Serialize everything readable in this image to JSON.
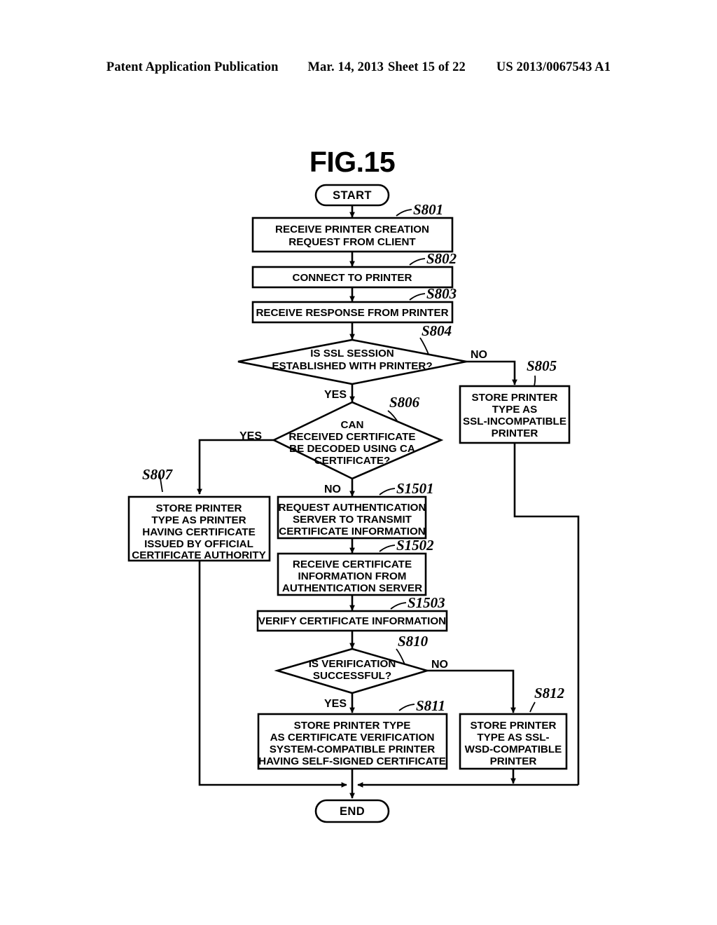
{
  "header": {
    "publication": "Patent Application Publication",
    "date": "Mar. 14, 2013",
    "sheet": "Sheet 15 of 22",
    "number": "US 2013/0067543 A1"
  },
  "figure": {
    "title": "FIG.15"
  },
  "nodes": {
    "start": {
      "id": "START",
      "text": "START",
      "type": "terminator"
    },
    "end": {
      "id": "END",
      "text": "END",
      "type": "terminator"
    },
    "s801": {
      "label": "S801",
      "type": "process",
      "lines": [
        "RECEIVE PRINTER CREATION",
        "REQUEST FROM CLIENT"
      ]
    },
    "s802": {
      "label": "S802",
      "type": "process",
      "lines": [
        "CONNECT TO PRINTER"
      ]
    },
    "s803": {
      "label": "S803",
      "type": "process",
      "lines": [
        "RECEIVE RESPONSE FROM PRINTER"
      ]
    },
    "s804": {
      "label": "S804",
      "type": "decision",
      "lines": [
        "IS SSL SESSION",
        "ESTABLISHED WITH PRINTER?"
      ],
      "yes": "YES",
      "no": "NO"
    },
    "s805": {
      "label": "S805",
      "type": "process",
      "lines": [
        "STORE PRINTER",
        "TYPE AS",
        "SSL-INCOMPATIBLE",
        "PRINTER"
      ]
    },
    "s806": {
      "label": "S806",
      "type": "decision",
      "lines": [
        "CAN",
        "RECEIVED CERTIFICATE",
        "BE DECODED USING CA",
        "CERTIFICATE?"
      ],
      "yes": "YES",
      "no": "NO"
    },
    "s807": {
      "label": "S807",
      "type": "process",
      "lines": [
        "STORE PRINTER",
        "TYPE AS PRINTER",
        "HAVING CERTIFICATE",
        "ISSUED BY OFFICIAL",
        "CERTIFICATE AUTHORITY"
      ]
    },
    "s1501": {
      "label": "S1501",
      "type": "process",
      "lines": [
        "REQUEST AUTHENTICATION",
        "SERVER TO TRANSMIT",
        "CERTIFICATE INFORMATION"
      ]
    },
    "s1502": {
      "label": "S1502",
      "type": "process",
      "lines": [
        "RECEIVE CERTIFICATE",
        "INFORMATION FROM",
        "AUTHENTICATION SERVER"
      ]
    },
    "s1503": {
      "label": "S1503",
      "type": "process",
      "lines": [
        "VERIFY CERTIFICATE INFORMATION"
      ]
    },
    "s810": {
      "label": "S810",
      "type": "decision",
      "lines": [
        "IS VERIFICATION",
        "SUCCESSFUL?"
      ],
      "yes": "YES",
      "no": "NO"
    },
    "s811": {
      "label": "S811",
      "type": "process",
      "lines": [
        "STORE PRINTER TYPE",
        "AS CERTIFICATE VERIFICATION",
        "SYSTEM-COMPATIBLE PRINTER",
        "HAVING SELF-SIGNED CERTIFICATE"
      ]
    },
    "s812": {
      "label": "S812",
      "type": "process",
      "lines": [
        "STORE PRINTER",
        "TYPE AS SSL-",
        "WSD-COMPATIBLE",
        "PRINTER"
      ]
    }
  },
  "colors": {
    "ink": "#000000",
    "paper": "#ffffff"
  }
}
